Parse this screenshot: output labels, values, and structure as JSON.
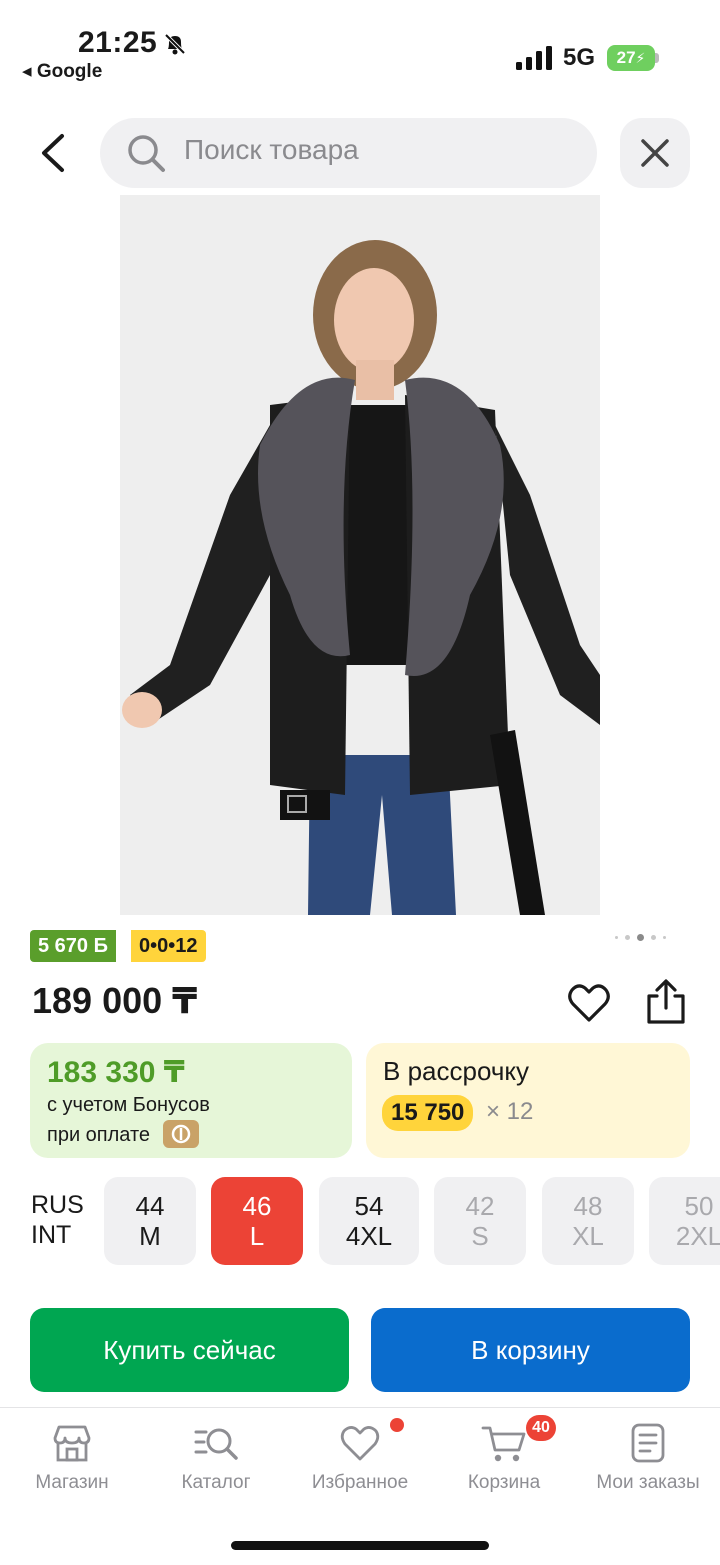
{
  "status": {
    "time": "21:25",
    "back_app": "◂ Google",
    "network": "5G",
    "battery": "27"
  },
  "search": {
    "placeholder": "Поиск товара"
  },
  "product": {
    "image_alt": "product-photo",
    "bonus_badge": "5 670 Б",
    "installment_badge": "0•0•12",
    "price": "189 000 ₸",
    "gallery_page": "3 of 5"
  },
  "bonus_card": {
    "value": "183 330 ₸",
    "line1": "с учетом Бонусов",
    "line2": "при оплате"
  },
  "installment_card": {
    "title": "В рассрочку",
    "amount": "15 750",
    "multiplier": "× 12"
  },
  "sizes": {
    "label_rus": "RUS",
    "label_int": "INT",
    "items": [
      {
        "rus": "44",
        "int": "M",
        "state": "available"
      },
      {
        "rus": "46",
        "int": "L",
        "state": "selected"
      },
      {
        "rus": "54",
        "int": "4XL",
        "state": "available"
      },
      {
        "rus": "42",
        "int": "S",
        "state": "unavailable"
      },
      {
        "rus": "48",
        "int": "XL",
        "state": "unavailable"
      },
      {
        "rus": "50",
        "int": "2XL",
        "state": "unavailable"
      }
    ]
  },
  "actions": {
    "buy_now": "Купить сейчас",
    "add_to_cart": "В корзину"
  },
  "tabbar": {
    "items": [
      {
        "label": "Магазин",
        "icon": "store-icon"
      },
      {
        "label": "Каталог",
        "icon": "catalog-search-icon"
      },
      {
        "label": "Избранное",
        "icon": "heart-icon"
      },
      {
        "label": "Корзина",
        "icon": "cart-icon"
      },
      {
        "label": "Мои заказы",
        "icon": "orders-icon"
      }
    ],
    "cart_count": "40"
  },
  "colors": {
    "accent_red": "#ec4336",
    "green": "#00a651",
    "blue": "#0a6ccd",
    "yellow": "#ffd43b"
  }
}
